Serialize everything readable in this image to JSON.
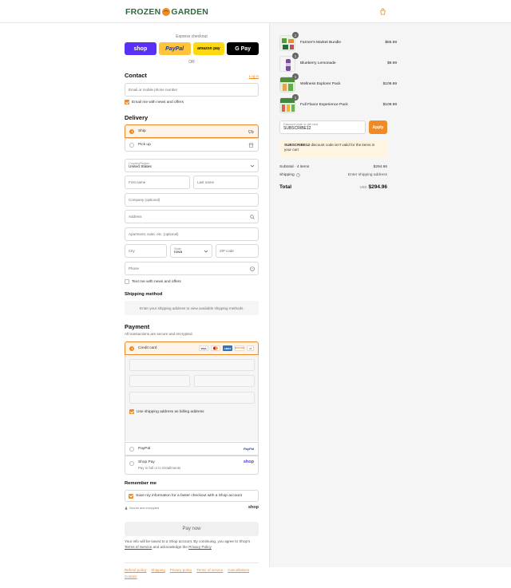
{
  "brand": {
    "name_left": "FROZEN",
    "name_right": "GARDEN"
  },
  "express": {
    "title": "Express checkout",
    "buttons": [
      "shop",
      "PayPal",
      "amazon pay",
      "G Pay"
    ],
    "or": "OR"
  },
  "contact": {
    "title": "Contact",
    "login": "Log in",
    "email_placeholder": "Email or mobile phone number",
    "news_label": "Email me with news and offers",
    "news_checked": true
  },
  "delivery": {
    "title": "Delivery",
    "options": [
      {
        "label": "Ship",
        "selected": true
      },
      {
        "label": "Pick up",
        "selected": false
      }
    ],
    "country_label": "Country/Region",
    "country_value": "United States",
    "first_name": "First name",
    "last_name": "Last name",
    "company": "Company (optional)",
    "address": "Address",
    "apartment": "Apartment, suite, etc. (optional)",
    "city": "City",
    "state_label": "State",
    "state_value": "Iowa",
    "zip": "ZIP code",
    "phone": "Phone",
    "text_label": "Text me with news and offers",
    "text_checked": false
  },
  "shipping_method": {
    "title": "Shipping method",
    "message": "Enter your shipping address to view available shipping methods."
  },
  "payment": {
    "title": "Payment",
    "subtitle": "All transactions are secure and encrypted.",
    "credit_card_label": "Credit card",
    "card_brands": [
      "VISA",
      "MC",
      "AMEX",
      "DISCOVER",
      "+5"
    ],
    "billing_same_label": "Use shipping address as billing address",
    "billing_same_checked": true,
    "paypal_label": "PayPal",
    "paypal_logo": "PayPal",
    "shoppay_label": "Shop Pay",
    "shoppay_sub": "Pay in full or in installments",
    "shoppay_logo": "shop"
  },
  "remember": {
    "title": "Remember me",
    "label": "Save my information for a faster checkout with a Shop account",
    "checked": true,
    "secure": "Secure and encrypted",
    "shop_logo": "shop"
  },
  "pay_now": "Pay now",
  "legal": {
    "text": "Your info will be saved to a Shop account. By continuing, you agree to Shop's",
    "tos": "Terms of Service",
    "mid": "and acknowledge the",
    "privacy": "Privacy Policy"
  },
  "footer_links": [
    "Refund policy",
    "Shipping",
    "Privacy policy",
    "Terms of service",
    "Cancellations",
    "Contact"
  ],
  "cart": {
    "items": [
      {
        "name": "Farmer's Market Bundle",
        "price": "$65.99",
        "qty": "1"
      },
      {
        "name": "Blueberry Lemonade",
        "price": "$9.99",
        "qty": "1"
      },
      {
        "name": "Wellness Explorer Pack",
        "price": "$109.99",
        "qty": "1"
      },
      {
        "name": "Full Flavor Experience Pack",
        "price": "$109.99",
        "qty": "1"
      }
    ],
    "discount_label": "Discount code or gift card",
    "discount_value": "SUBSCRIBE12",
    "apply": "Apply",
    "notice_code": "SUBSCRIBE12",
    "notice_text": " discount code isn't valid for the items in your cart",
    "subtotal_label": "Subtotal · 4 items",
    "subtotal_value": "$294.96",
    "shipping_label": "Shipping",
    "shipping_value": "Enter shipping address",
    "total_label": "Total",
    "total_currency": "USD",
    "total_value": "$294.96"
  },
  "colors": {
    "accent": "#f08a24",
    "brand_green": "#2e6b3a",
    "shop_purple": "#5a31f4"
  }
}
